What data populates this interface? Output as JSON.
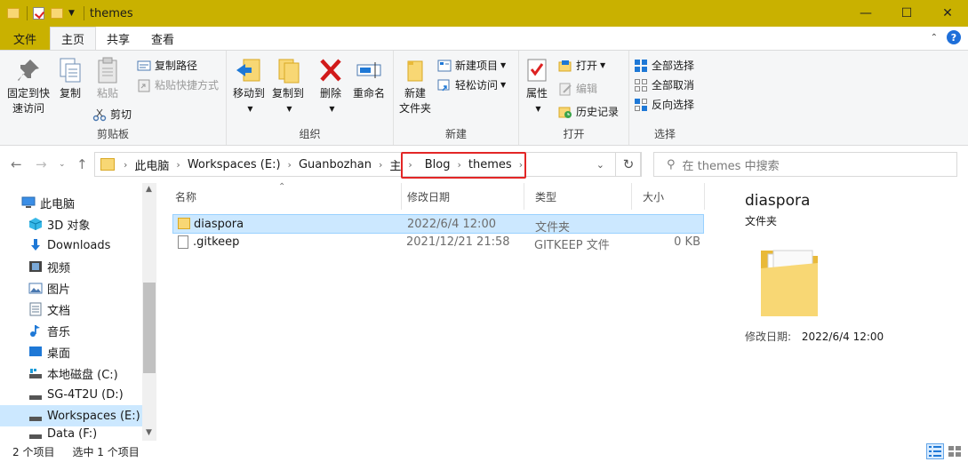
{
  "window": {
    "title": "themes"
  },
  "tabs": {
    "file": "文件",
    "home": "主页",
    "share": "共享",
    "view": "查看"
  },
  "ribbon": {
    "clipboard": {
      "label": "剪贴板",
      "pin": "固定到快速访问",
      "pin_line1": "固定到快",
      "pin_line2": "速访问",
      "copy": "复制",
      "paste": "粘贴",
      "copy_path": "复制路径",
      "paste_shortcut": "粘贴快捷方式",
      "cut": "剪切"
    },
    "organize": {
      "label": "组织",
      "move_to": "移动到",
      "copy_to": "复制到",
      "delete": "删除",
      "rename": "重命名"
    },
    "new": {
      "label": "新建",
      "new_item": "新建项目",
      "easy_access": "轻松访问",
      "new_folder_line1": "新建",
      "new_folder_line2": "文件夹"
    },
    "open": {
      "label": "打开",
      "properties": "属性",
      "open": "打开",
      "edit": "编辑",
      "history": "历史记录"
    },
    "select": {
      "label": "选择",
      "select_all": "全部选择",
      "select_none": "全部取消",
      "invert": "反向选择"
    }
  },
  "address": {
    "crumbs": [
      "此电脑",
      "Workspaces (E:)",
      "Guanbozhan",
      "主",
      "Blog",
      "themes"
    ],
    "search_placeholder": "在 themes 中搜索"
  },
  "nav": {
    "items": [
      {
        "label": "此电脑",
        "icon": "pc-icon"
      },
      {
        "label": "3D 对象",
        "icon": "cube-icon"
      },
      {
        "label": "Downloads",
        "icon": "download-icon"
      },
      {
        "label": "视频",
        "icon": "video-icon"
      },
      {
        "label": "图片",
        "icon": "picture-icon"
      },
      {
        "label": "文档",
        "icon": "document-icon"
      },
      {
        "label": "音乐",
        "icon": "music-icon"
      },
      {
        "label": "桌面",
        "icon": "desktop-icon"
      },
      {
        "label": "本地磁盘 (C:)",
        "icon": "disk-icon"
      },
      {
        "label": "SG-4T2U (D:)",
        "icon": "drive-icon"
      },
      {
        "label": "Workspaces (E:)",
        "icon": "drive-icon"
      },
      {
        "label": "Data (F:)",
        "icon": "drive-icon"
      }
    ],
    "selected_index": 10
  },
  "list": {
    "columns": {
      "name": "名称",
      "modified": "修改日期",
      "type": "类型",
      "size": "大小"
    },
    "rows": [
      {
        "name": "diaspora",
        "modified": "2022/6/4 12:00",
        "type": "文件夹",
        "size": ""
      },
      {
        "name": ".gitkeep",
        "modified": "2021/12/21 21:58",
        "type": "GITKEEP 文件",
        "size": "0 KB"
      }
    ]
  },
  "preview": {
    "name": "diaspora",
    "kind": "文件夹",
    "modified_label": "修改日期:",
    "modified_value": "2022/6/4 12:00"
  },
  "status": {
    "count": "2 个项目",
    "selected": "选中 1 个项目"
  },
  "colors": {
    "titlebar": "#c9b100",
    "selection": "#cce8ff",
    "highlight_box": "#e32626"
  }
}
